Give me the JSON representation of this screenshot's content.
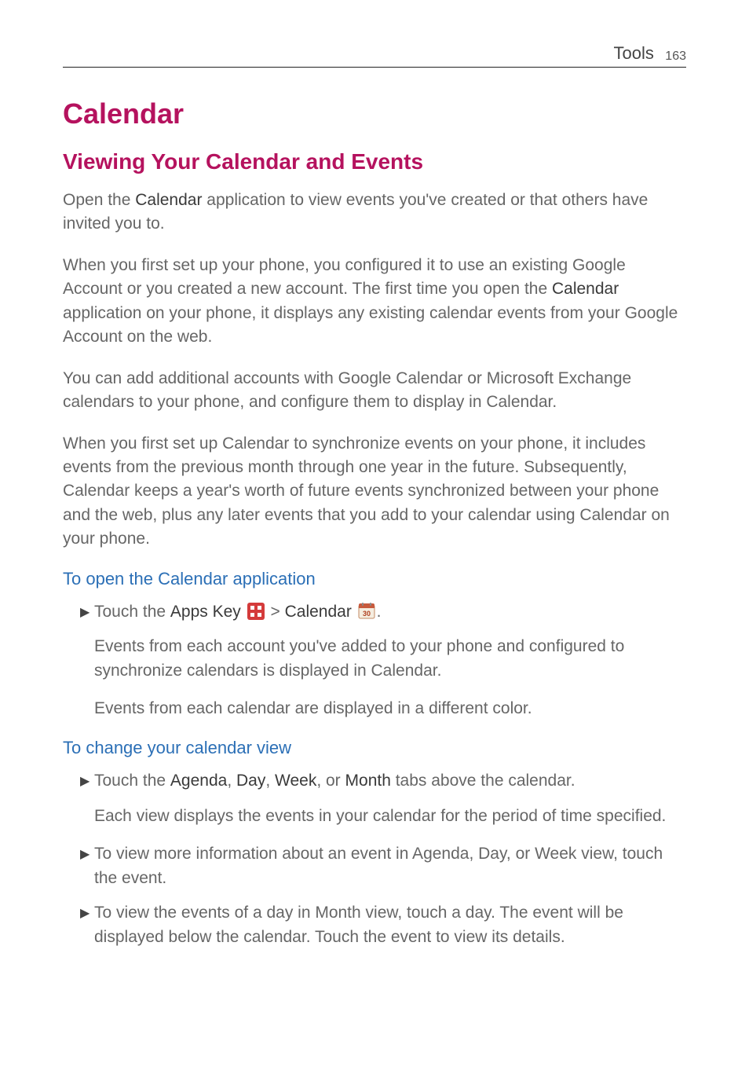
{
  "header": {
    "section_label": "Tools",
    "page_number": "163"
  },
  "title": "Calendar",
  "subtitle": "Viewing Your Calendar and Events",
  "para1_pre": "Open the ",
  "para1_bold": "Calendar",
  "para1_post": " application to view events you've created or that others have invited you to.",
  "para2_pre": "When you first set up your phone, you configured it to use an existing Google Account or you created a new account. The first time you open the ",
  "para2_bold": "Calendar",
  "para2_post": " application on your phone, it displays any existing calendar events from your Google Account on the web.",
  "para3": "You can add additional accounts with Google Calendar or Microsoft Exchange calendars to your phone, and configure them to display in Calendar.",
  "para4": "When you first set up Calendar to synchronize events on your phone, it includes events from the previous month through one year in the future. Subsequently, Calendar keeps a year's worth of future events synchronized between your phone and the web, plus any later events that you add to your calendar using Calendar on your phone.",
  "section_open": {
    "heading": "To open the Calendar application",
    "b1_pre": "Touch the ",
    "b1_b1": "Apps Key",
    "b1_mid": " > ",
    "b1_b2": "Calendar",
    "b1_end": ".",
    "indent1": "Events from each account you've added to your phone and configured to synchronize calendars is displayed in Calendar.",
    "indent2": "Events from each calendar are displayed in a different color."
  },
  "section_change": {
    "heading": "To change your calendar view",
    "b1_pre": "Touch the ",
    "b1_b1": "Agenda",
    "b1_s1": ", ",
    "b1_b2": "Day",
    "b1_s2": ", ",
    "b1_b3": "Week",
    "b1_s3": ", or ",
    "b1_b4": "Month",
    "b1_post": " tabs above the calendar.",
    "indent1": "Each view displays the events in your calendar for the period of time specified.",
    "b2": "To view more information about an event in Agenda, Day, or Week view, touch the event.",
    "b3": "To view the events of a day in Month view, touch a day. The event will be displayed below the calendar. Touch the event to view its details."
  },
  "icons": {
    "apps_bg": "#d43b3b",
    "cal_border": "#c06a4a",
    "cal_number": "30"
  }
}
